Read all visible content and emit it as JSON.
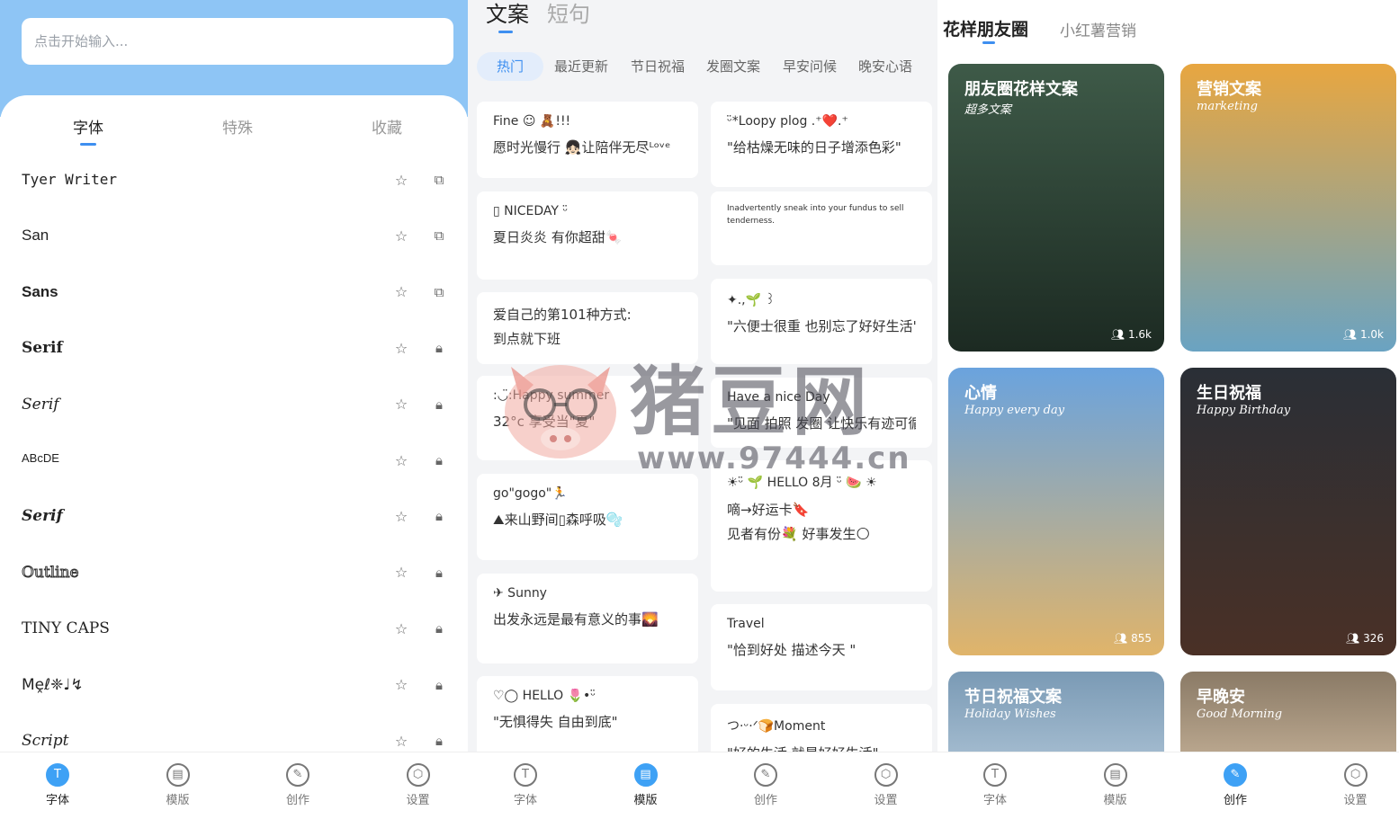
{
  "screen1": {
    "search_placeholder": "点击开始输入...",
    "tabs": [
      "字体",
      "特殊",
      "收藏"
    ],
    "fonts": [
      {
        "name": "Tyer Writer",
        "locked": false
      },
      {
        "name": "San",
        "locked": false
      },
      {
        "name": "Sans",
        "locked": false
      },
      {
        "name": "Serif",
        "locked": true
      },
      {
        "name": "Serif",
        "locked": true
      },
      {
        "name": "ABcDE",
        "locked": true
      },
      {
        "name": "Serif",
        "locked": true
      },
      {
        "name": "Outline",
        "locked": true
      },
      {
        "name": "TINY CAPS",
        "locked": true
      },
      {
        "name": "Mḙℓ❈♩↯",
        "locked": true
      },
      {
        "name": "Script",
        "locked": true
      }
    ],
    "nav": [
      "字体",
      "模版",
      "创作",
      "设置"
    ],
    "active_nav": 0
  },
  "screen2": {
    "tabs": [
      "文案",
      "短句"
    ],
    "categories": [
      "热门",
      "最近更新",
      "节日祝福",
      "发圈文案",
      "早安问候",
      "晚安心语"
    ],
    "cards_left": [
      {
        "l1": "Fine ☺︎ 🧸!!!",
        "l2": "愿时光慢行 👧🏻让陪伴无尽ᴸᵒᵛᵉ"
      },
      {
        "l1": "▯ NICEDAY ᵕ̈",
        "l2": "夏日炎炎 有你超甜🍬"
      },
      {
        "l1": "",
        "l2": "爱自己的第101种方式:",
        "l3": "到点就下班"
      },
      {
        "l1": ":◡̈:Happy summer",
        "l2": "32°c 享受当\"夏\""
      },
      {
        "l1": "go\"gogo\"🏃",
        "l2": "⛰来山野间▯森呼吸🫧"
      },
      {
        "l1": "✈ Sunny",
        "l2": "出发永远是最有意义的事🌄"
      },
      {
        "l1": "♡◯ HELLO 🌷•ᵕ̈",
        "l2": "\"无惧得失 自由到底\""
      }
    ],
    "cards_right": [
      {
        "l1": "ᵕ̈*Loopy plog .⁺❤️.⁺",
        "l2": "\"给枯燥无味的日子增添色彩\""
      },
      {
        "l1": "Inadvertently sneak into your fundus to sell",
        "l2": "tenderness."
      },
      {
        "l1": "✦.,🌱 ꒱",
        "l2": "\"六便士很重 也别忘了好好生活\""
      },
      {
        "l1": "Have a nice Day",
        "l2": "\"见面 拍照 发圈 让快乐有迹可循\""
      },
      {
        "l1": "☀︎ᵕ̈ 🌱 HELLO 8月 ᵕ̈ 🍉 ☀︎",
        "l2": "嘀→好运卡🔖",
        "l3": "见者有份💐 好事发生🌕"
      },
      {
        "l1": "Travel",
        "l2": "\"恰到好处 描述今天 \""
      },
      {
        "l1": "つ·ᵕ·ᐟ🍞Moment",
        "l2": "\"好的生活 就是好好生活\""
      }
    ],
    "nav": [
      "字体",
      "模版",
      "创作",
      "设置"
    ],
    "active_nav": 1
  },
  "screen3": {
    "tabs": [
      "花样朋友圈",
      "小红薯营销"
    ],
    "tiles": [
      {
        "title": "朋友圈花样文案",
        "subtitle": "超多文案",
        "count": "1.6k",
        "color_top": "#3e5a48",
        "color_bottom": "#1c2a22"
      },
      {
        "title": "营销文案",
        "subtitle": "marketing",
        "count": "1.0k",
        "color_top": "#e8a640",
        "color_bottom": "#6aa3c2"
      },
      {
        "title": "心情",
        "subtitle": "Happy every day",
        "count": "855",
        "color_top": "#6aa3de",
        "color_bottom": "#e0b46a"
      },
      {
        "title": "生日祝福",
        "subtitle": "Happy Birthday",
        "count": "326",
        "color_top": "#2a2f36",
        "color_bottom": "#4a3026"
      },
      {
        "title": "节日祝福文案",
        "subtitle": "Holiday Wishes",
        "count": "",
        "color_top": "#7a9ab5",
        "color_bottom": "#aec4d6"
      },
      {
        "title": "早晚安",
        "subtitle": "Good Morning",
        "count": "",
        "color_top": "#8a7a66",
        "color_bottom": "#c8b49a"
      }
    ],
    "nav": [
      "字体",
      "模版",
      "创作",
      "设置"
    ],
    "active_nav": 2
  },
  "watermark": {
    "title": "猪豆网",
    "url": "www.97444.cn"
  },
  "colors": {
    "accent": "#3e8ff0",
    "header_blue": "#8ec5f5",
    "nav_active": "#3ea1f5"
  }
}
